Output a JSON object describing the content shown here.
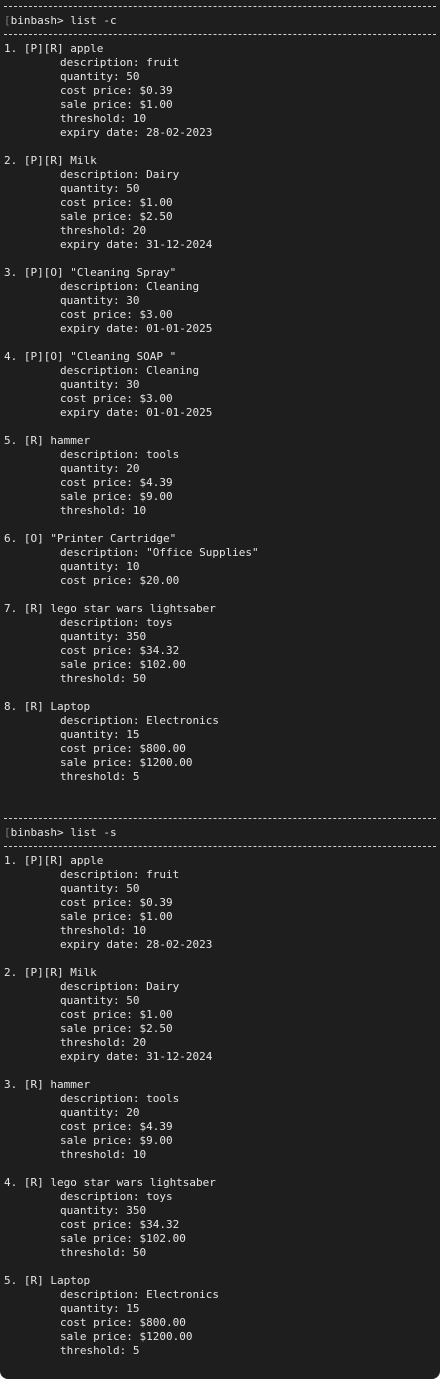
{
  "colors": {
    "background": "#1e1e1e",
    "text": "#e6e6e6",
    "separator": "#d0d0d0"
  },
  "sections": [
    {
      "prompt": "binbash> list -c",
      "items": [
        {
          "header": "1. [P][R] apple",
          "fields": [
            "description: fruit",
            "quantity: 50",
            "cost price: $0.39",
            "sale price: $1.00",
            "threshold: 10",
            "expiry date: 28-02-2023"
          ]
        },
        {
          "header": "2. [P][R] Milk",
          "fields": [
            "description: Dairy",
            "quantity: 50",
            "cost price: $1.00",
            "sale price: $2.50",
            "threshold: 20",
            "expiry date: 31-12-2024"
          ]
        },
        {
          "header": "3. [P][O] \"Cleaning Spray\"",
          "fields": [
            "description: Cleaning",
            "quantity: 30",
            "cost price: $3.00",
            "expiry date: 01-01-2025"
          ]
        },
        {
          "header": "4. [P][O] \"Cleaning SOAP \"",
          "fields": [
            "description: Cleaning",
            "quantity: 30",
            "cost price: $3.00",
            "expiry date: 01-01-2025"
          ]
        },
        {
          "header": "5. [R] hammer",
          "fields": [
            "description: tools",
            "quantity: 20",
            "cost price: $4.39",
            "sale price: $9.00",
            "threshold: 10"
          ]
        },
        {
          "header": "6. [O] \"Printer Cartridge\"",
          "fields": [
            "description: \"Office Supplies\"",
            "quantity: 10",
            "cost price: $20.00"
          ]
        },
        {
          "header": "7. [R] lego star wars lightsaber",
          "fields": [
            "description: toys",
            "quantity: 350",
            "cost price: $34.32",
            "sale price: $102.00",
            "threshold: 50"
          ]
        },
        {
          "header": "8. [R] Laptop",
          "fields": [
            "description: Electronics",
            "quantity: 15",
            "cost price: $800.00",
            "sale price: $1200.00",
            "threshold: 5"
          ]
        }
      ]
    },
    {
      "prompt": "binbash> list -s",
      "items": [
        {
          "header": "1. [P][R] apple",
          "fields": [
            "description: fruit",
            "quantity: 50",
            "cost price: $0.39",
            "sale price: $1.00",
            "threshold: 10",
            "expiry date: 28-02-2023"
          ]
        },
        {
          "header": "2. [P][R] Milk",
          "fields": [
            "description: Dairy",
            "quantity: 50",
            "cost price: $1.00",
            "sale price: $2.50",
            "threshold: 20",
            "expiry date: 31-12-2024"
          ]
        },
        {
          "header": "3. [R] hammer",
          "fields": [
            "description: tools",
            "quantity: 20",
            "cost price: $4.39",
            "sale price: $9.00",
            "threshold: 10"
          ]
        },
        {
          "header": "4. [R] lego star wars lightsaber",
          "fields": [
            "description: toys",
            "quantity: 350",
            "cost price: $34.32",
            "sale price: $102.00",
            "threshold: 50"
          ]
        },
        {
          "header": "5. [R] Laptop",
          "fields": [
            "description: Electronics",
            "quantity: 15",
            "cost price: $800.00",
            "sale price: $1200.00",
            "threshold: 5"
          ]
        }
      ]
    }
  ]
}
